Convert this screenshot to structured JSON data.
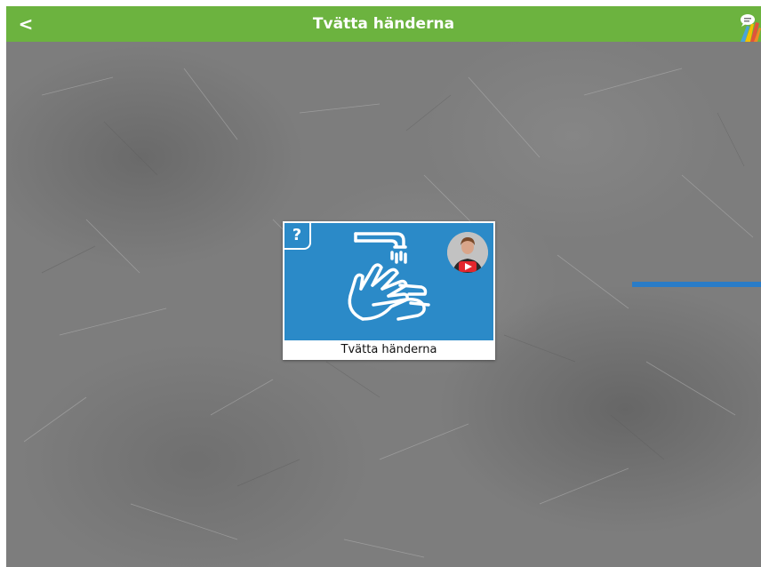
{
  "header": {
    "back_label": "<",
    "title": "Tvätta händerna",
    "logo_icon": "app-logo-icon",
    "background_color": "#6cb33f"
  },
  "card": {
    "label": "Tvätta händerna",
    "help_badge": "?",
    "pictogram_icon": "hand-washing-icon",
    "video_icon": "sign-language-video-icon",
    "image_background_color": "#2b8ac8"
  },
  "canvas": {
    "background": "grey-concrete-texture",
    "line_color": "#2a7cc7"
  }
}
